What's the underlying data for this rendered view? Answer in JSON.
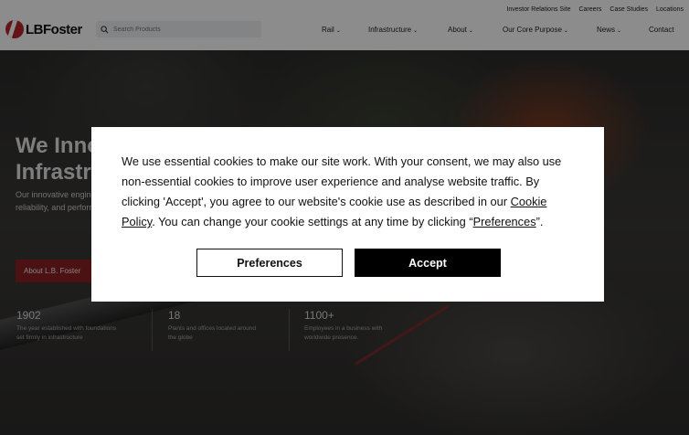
{
  "header": {
    "brand": "LBFoster",
    "utility_links": [
      "Investor Relations Site",
      "Careers",
      "Case Studies",
      "Locations"
    ],
    "search_placeholder": "Search Products",
    "nav": [
      {
        "label": "Rail",
        "dropdown": true
      },
      {
        "label": "Infrastructure",
        "dropdown": true
      },
      {
        "label": "About",
        "dropdown": true
      },
      {
        "label": "Our Core Purpose",
        "dropdown": true
      },
      {
        "label": "News",
        "dropdown": true
      },
      {
        "label": "Contact",
        "dropdown": false
      }
    ]
  },
  "hero": {
    "title_line1": "We Innovate",
    "title_line2": "Infrastructure",
    "subtitle_line1": "Our innovative engineering",
    "subtitle_line2": "reliability, and performance",
    "button_label": "About L.B. Foster",
    "stats": [
      {
        "number": "1902",
        "text_line1": "The year established with foundations",
        "text_line2": "set firmly in infrastructure"
      },
      {
        "number": "18",
        "text_line1": "Plants and offices located around",
        "text_line2": "the globe"
      },
      {
        "number": "1100+",
        "text_line1": "Employees in a business with",
        "text_line2": "worldwide presence."
      }
    ]
  },
  "cookie_modal": {
    "text_before_link": "We use essential cookies to make our site work. With your consent, we may also use non-essential cookies to improve user experience and analyse website traffic. By clicking 'Accept', you agree to our website's cookie use as described in our ",
    "cookie_policy_link": "Cookie Policy",
    "text_middle": ". You can change your cookie settings at any time by clicking “",
    "preferences_link": "Preferences",
    "text_end": "”.",
    "preferences_button": "Preferences",
    "accept_button": "Accept"
  },
  "colors": {
    "brand_red": "#b3262b",
    "hero_button": "#8a1f23",
    "accept_bg": "#000000"
  }
}
